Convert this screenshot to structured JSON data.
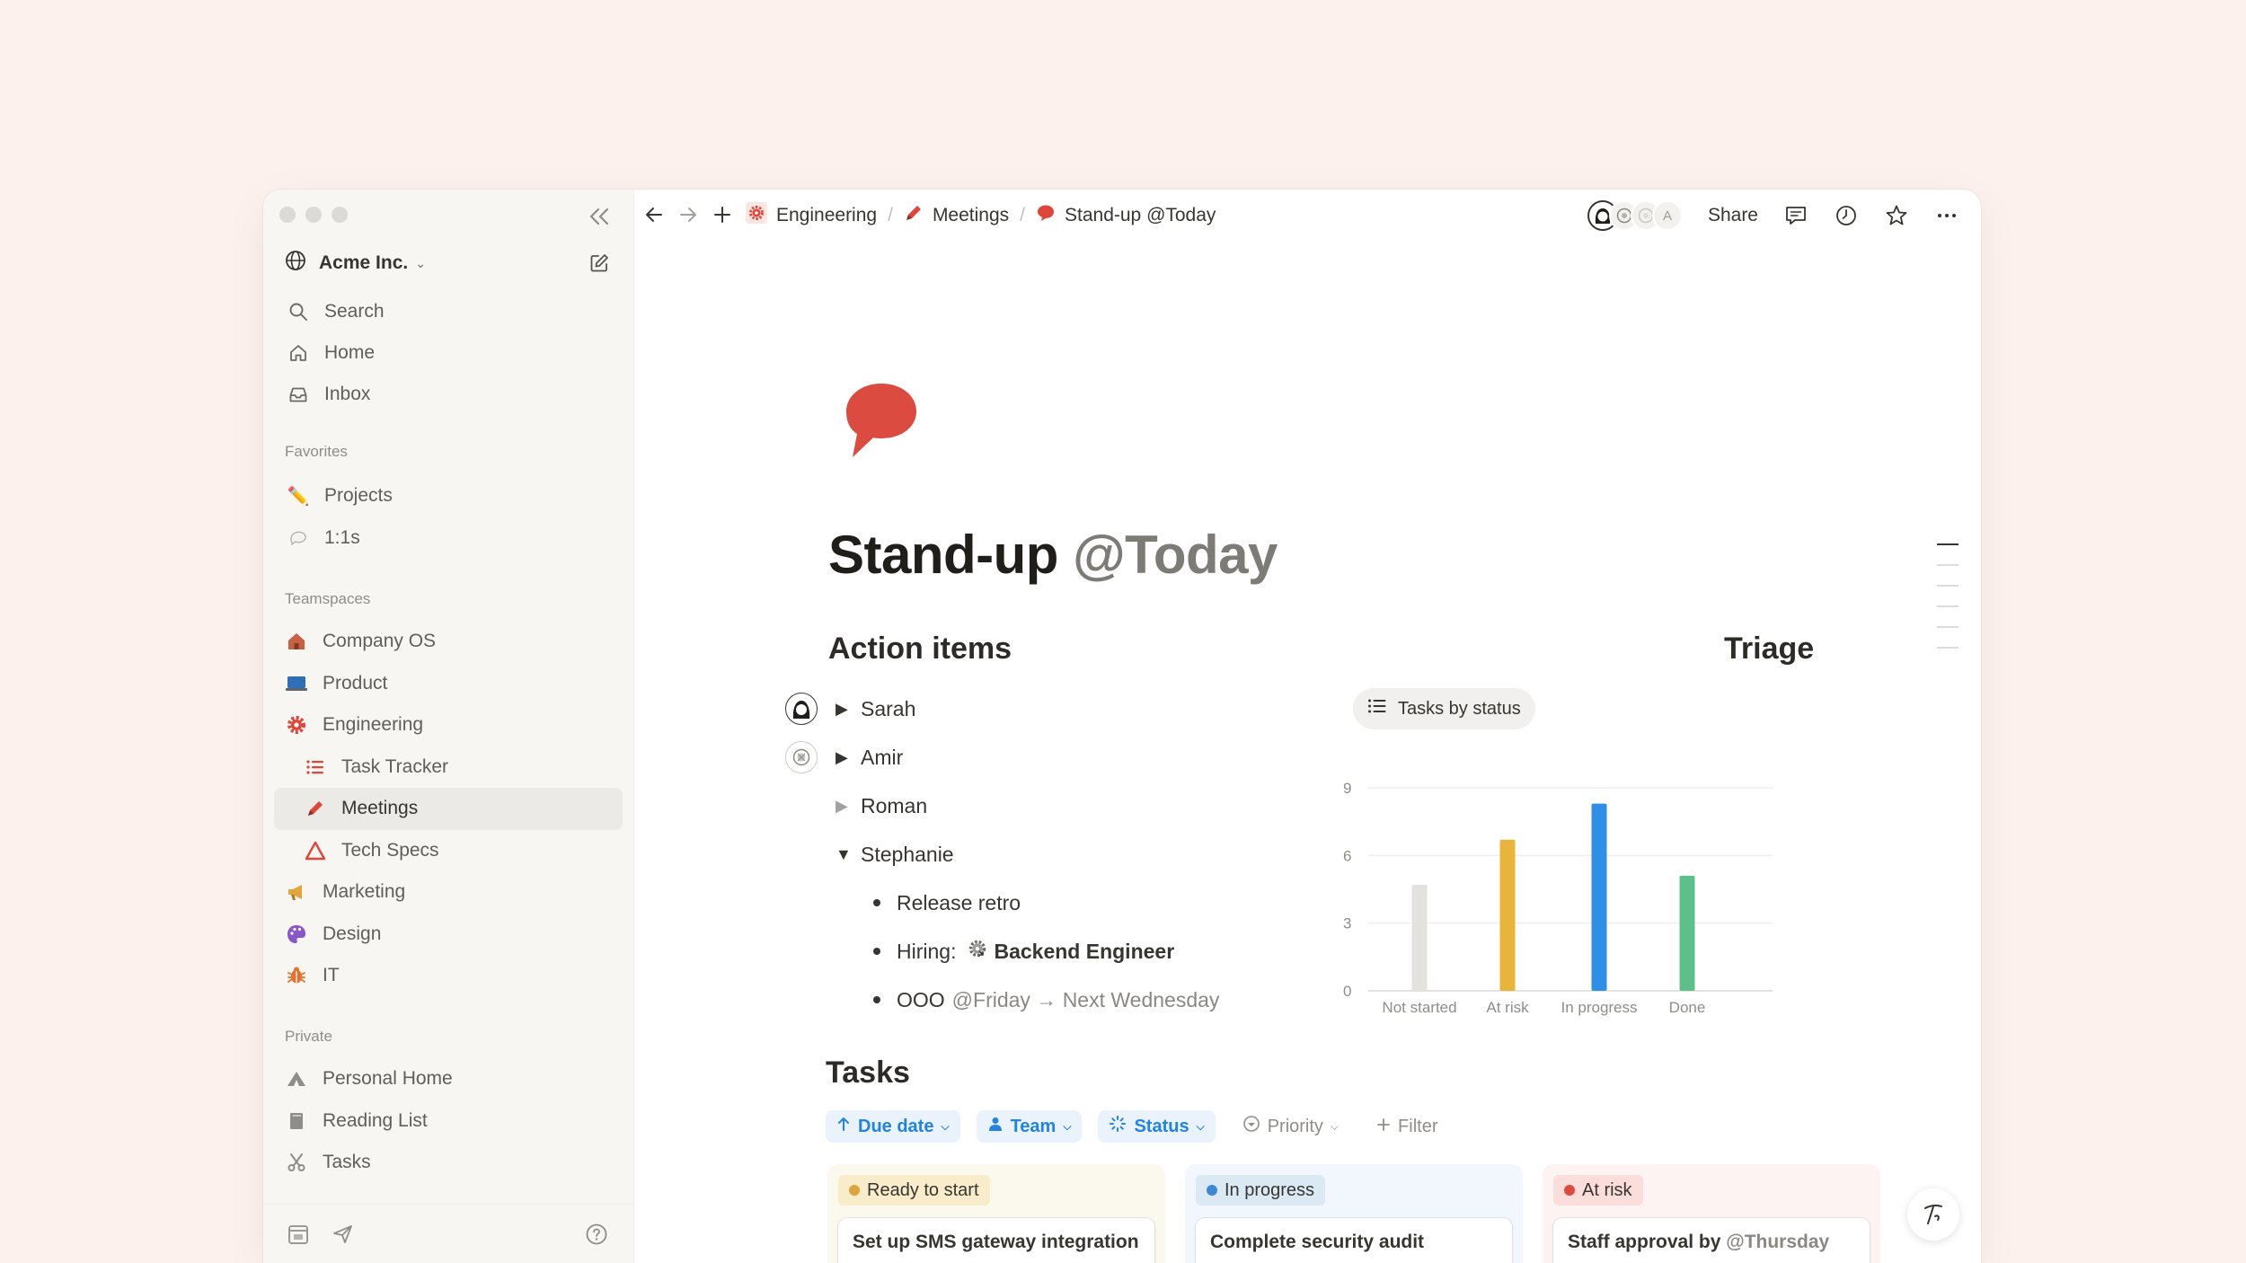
{
  "workspace": {
    "name": "Acme Inc."
  },
  "sidebar": {
    "nav": [
      {
        "label": "Search",
        "icon": "search-icon"
      },
      {
        "label": "Home",
        "icon": "home-icon"
      },
      {
        "label": "Inbox",
        "icon": "inbox-icon"
      }
    ],
    "favorites_label": "Favorites",
    "favorites": [
      {
        "label": "Projects",
        "icon": "pencil-icon"
      },
      {
        "label": "1:1s",
        "icon": "chat-bubble-icon"
      }
    ],
    "teamspaces_label": "Teamspaces",
    "teamspaces": [
      {
        "label": "Company OS",
        "icon": "house-icon"
      },
      {
        "label": "Product",
        "icon": "laptop-icon"
      },
      {
        "label": "Engineering",
        "icon": "gear-icon"
      },
      {
        "label": "Task Tracker",
        "icon": "list-icon"
      },
      {
        "label": "Meetings",
        "icon": "pencil-icon"
      },
      {
        "label": "Tech Specs",
        "icon": "triangle-icon"
      },
      {
        "label": "Marketing",
        "icon": "megaphone-icon"
      },
      {
        "label": "Design",
        "icon": "palette-icon"
      },
      {
        "label": "IT",
        "icon": "bug-icon"
      }
    ],
    "private_label": "Private",
    "private": [
      {
        "label": "Personal Home",
        "icon": "home-sketch-icon"
      },
      {
        "label": "Reading List",
        "icon": "book-icon"
      },
      {
        "label": "Tasks",
        "icon": "scissors-icon"
      }
    ]
  },
  "breadcrumbs": [
    {
      "label": "Engineering",
      "icon": "gear-icon"
    },
    {
      "label": "Meetings",
      "icon": "pencil-icon"
    },
    {
      "label": "Stand-up @Today",
      "icon": "speech-bubble-icon"
    }
  ],
  "topbar": {
    "share_label": "Share",
    "avatar_initial": "A"
  },
  "page": {
    "title": "Stand-up",
    "title_mention": "@Today",
    "action_items_heading": "Action items",
    "people": [
      {
        "name": "Sarah"
      },
      {
        "name": "Amir"
      },
      {
        "name": "Roman"
      },
      {
        "name": "Stephanie"
      }
    ],
    "stephanie_items": [
      {
        "text": "Release retro"
      },
      {
        "prefix": "Hiring:",
        "link": "Backend Engineer"
      },
      {
        "prefix": "OOO",
        "mention": "@Friday → Next Wednesday"
      }
    ],
    "triage_heading": "Triage",
    "triage_view": "Tasks by status",
    "tasks_heading": "Tasks",
    "filters": [
      {
        "label": "Due date"
      },
      {
        "label": "Team"
      },
      {
        "label": "Status"
      },
      {
        "label": "Priority"
      },
      {
        "label": "Filter"
      }
    ],
    "columns": [
      {
        "status": "Ready to start",
        "card": "Set up SMS gateway integration",
        "bg": "#fbf8ee",
        "tag_bg": "#f9eccb",
        "dot": "#dca43a"
      },
      {
        "status": "In progress",
        "card": "Complete security audit",
        "bg": "#f1f7fc",
        "tag_bg": "#dbe9f5",
        "dot": "#3a8ad6"
      },
      {
        "status": "At risk",
        "card": "Staff approval by",
        "card_mention": "@Thursday",
        "bg": "#fdf3f2",
        "tag_bg": "#fbdddb",
        "dot": "#e04a3d"
      }
    ]
  },
  "chart_data": {
    "type": "bar",
    "categories": [
      "Not started",
      "At risk",
      "In progress",
      "Done"
    ],
    "values": [
      4.7,
      6.7,
      8.3,
      5.1
    ],
    "colors": [
      "#e3e2df",
      "#e8b43a",
      "#2f8fe8",
      "#5dbf8a"
    ],
    "ylim": [
      0,
      9
    ],
    "yticks": [
      0,
      3,
      6,
      9
    ],
    "grid": true
  }
}
